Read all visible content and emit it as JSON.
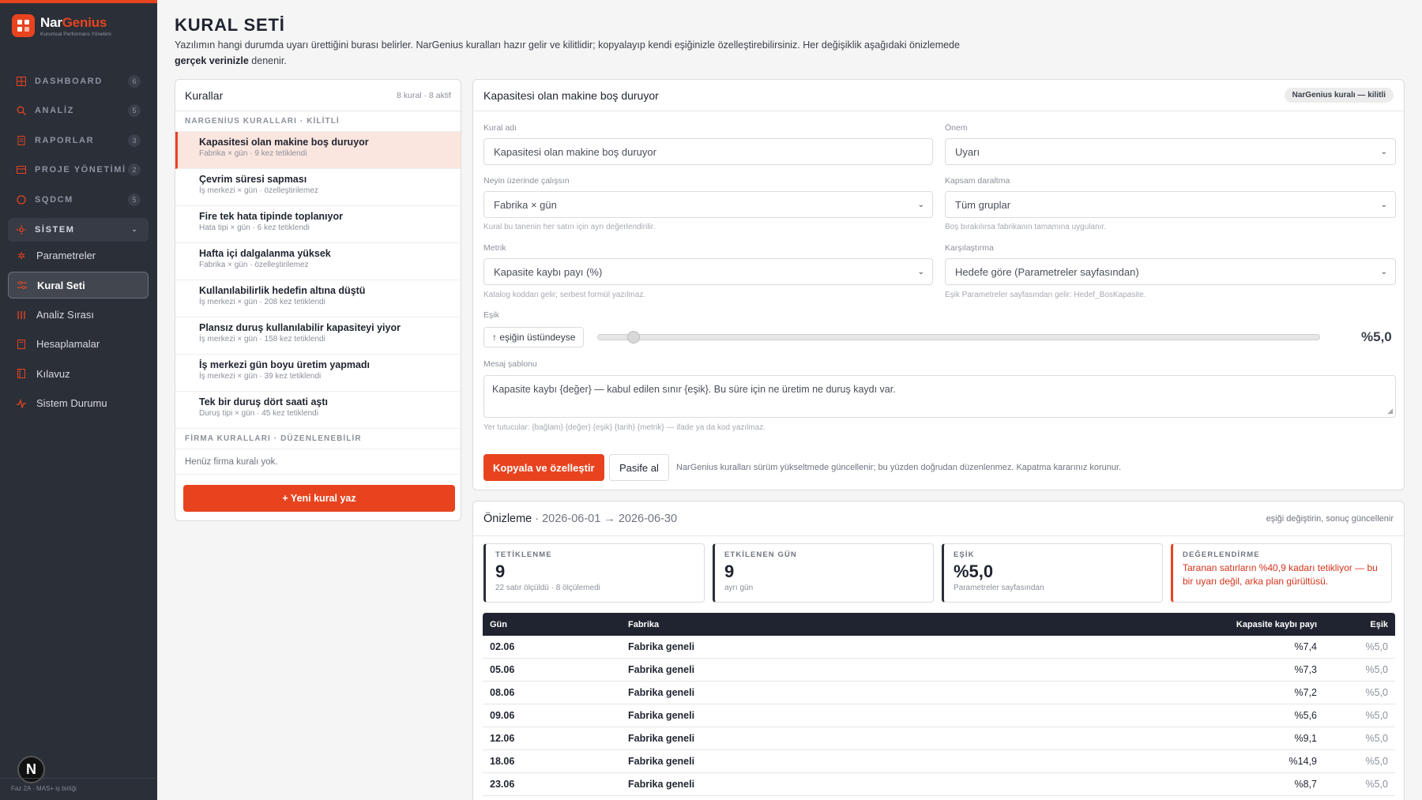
{
  "brand": {
    "name_a": "Nar",
    "name_b": "Genius",
    "subtitle": "Kurumsal Performans Yönetimi"
  },
  "nav": [
    {
      "label": "DASHBOARD",
      "count": "6",
      "icon": "dashboard-icon"
    },
    {
      "label": "ANALİZ",
      "count": "5",
      "icon": "search-icon"
    },
    {
      "label": "RAPORLAR",
      "count": "3",
      "icon": "report-icon"
    },
    {
      "label": "PROJE YÖNETİMİ",
      "count": "2",
      "icon": "project-icon"
    },
    {
      "label": "SQDCM",
      "count": "5",
      "icon": "shield-icon"
    },
    {
      "label": "SİSTEM",
      "count": "⌄",
      "icon": "gear-icon"
    }
  ],
  "subnav": [
    {
      "label": "Parametreler",
      "icon": "gear-icon"
    },
    {
      "label": "Kural Seti",
      "icon": "sliders-icon"
    },
    {
      "label": "Analiz Sırası",
      "icon": "bars-icon"
    },
    {
      "label": "Hesaplamalar",
      "icon": "calculator-icon"
    },
    {
      "label": "Kılavuz",
      "icon": "book-icon"
    },
    {
      "label": "Sistem Durumu",
      "icon": "pulse-icon"
    }
  ],
  "avatar": "N",
  "footer": "Faz 2A · MAS+ iş birliği",
  "page": {
    "title": "KURAL SETİ",
    "desc_a": "Yazılımın hangi durumda uyarı ürettiğini burası belirler. NarGenius kuralları hazır gelir ve kilitlidir; kopyalayıp kendi eşiğinizle özelleştirebilirsiniz. Her değişiklik aşağıdaki önizlemede ",
    "desc_b": "gerçek verinizle",
    "desc_c": " denenir."
  },
  "rules": {
    "title": "Kurallar",
    "meta": "8 kural · 8 aktif",
    "group_locked": "NARGENİUS KURALLARI · KİLİTLİ",
    "items": [
      {
        "title": "Kapasitesi olan makine boş duruyor",
        "sub": "Fabrika × gün · 9 kez tetiklendi"
      },
      {
        "title": "Çevrim süresi sapması",
        "sub": "İş merkezi × gün · özelleştirilemez"
      },
      {
        "title": "Fire tek hata tipinde toplanıyor",
        "sub": "Hata tipi × gün · 6 kez tetiklendi"
      },
      {
        "title": "Hafta içi dalgalanma yüksek",
        "sub": "Fabrika × gün · özelleştirilemez"
      },
      {
        "title": "Kullanılabilirlik hedefin altına düştü",
        "sub": "İş merkezi × gün · 208 kez tetiklendi"
      },
      {
        "title": "Plansız duruş kullanılabilir kapasiteyi yiyor",
        "sub": "İş merkezi × gün · 158 kez tetiklendi"
      },
      {
        "title": "İş merkezi gün boyu üretim yapmadı",
        "sub": "İş merkezi × gün · 39 kez tetiklendi"
      },
      {
        "title": "Tek bir duruş dört saati aştı",
        "sub": "Duruş tipi × gün · 45 kez tetiklendi"
      }
    ],
    "group_editable": "FİRMA KURALLARI · DÜZENLENEBİLİR",
    "empty": "Henüz firma kuralı yok.",
    "new_button": "+ Yeni kural yaz"
  },
  "editor": {
    "title": "Kapasitesi olan makine boş duruyor",
    "badge": "NarGenius kuralı — kilitli",
    "name_label": "Kural adı",
    "name_value": "Kapasitesi olan makine boş duruyor",
    "severity_label": "Önem",
    "severity_value": "Uyarı",
    "target_label": "Neyin üzerinde çalışsın",
    "target_value": "Fabrika × gün",
    "target_hint": "Kural bu tanenin her satırı için ayrı değerlendirilir.",
    "scope_label": "Kapsam daraltma",
    "scope_value": "Tüm gruplar",
    "scope_hint": "Boş bırakılırsa fabrikanın tamamına uygulanır.",
    "metric_label": "Metrik",
    "metric_value": "Kapasite kaybı payı (%)",
    "metric_hint": "Katalog koddan gelir; serbest formül yazılmaz.",
    "compare_label": "Karşılaştırma",
    "compare_value": "Hedefe göre (Parametreler sayfasından)",
    "compare_hint": "Eşik Parametreler sayfasından gelir: Hedef_BosKapasite.",
    "threshold_label": "Eşik",
    "direction": "↑ eşiğin üstündeyse",
    "threshold_value": "%5,0",
    "threshold_fraction": 0.05,
    "message_label": "Mesaj şablonu",
    "message_value": "Kapasite kaybı {değer} — kabul edilen sınır {eşik}. Bu süre için ne üretim ne duruş kaydı var.",
    "message_hint": "Yer tutucular: {bağlam} {değer} {eşik} {tarih} {metrik} — ifade ya da kod yazılmaz.",
    "copy_button": "Kopyala ve özelleştir",
    "deactivate_button": "Pasife al",
    "note": "NarGenius kuralları sürüm yükseltmede güncellenir; bu yüzden doğrudan düzenlenmez. Kapatma kararınız korunur."
  },
  "preview": {
    "title": "Önizleme",
    "range": "· 2026-06-01 → 2026-06-30",
    "right": "eşiği değiştirin, sonuç güncellenir",
    "stats": {
      "trig_k": "TETİKLENME",
      "trig_v": "9",
      "trig_s": "22 satır ölçüldü · 8 ölçülemedi",
      "days_k": "ETKİLENEN GÜN",
      "days_v": "9",
      "days_s": "ayrı gün",
      "thr_k": "EŞİK",
      "thr_v": "%5,0",
      "thr_s": "Parametreler sayfasından",
      "eval_k": "DEĞERLENDİRME",
      "eval_w": "Taranan satırların %40,9 kadarı tetikliyor — bu bir uyarı değil, arka plan gürültüsü."
    },
    "table": {
      "headers": [
        "Gün",
        "Fabrika",
        "Kapasite kaybı payı",
        "Eşik"
      ],
      "rows": [
        [
          "02.06",
          "Fabrika geneli",
          "%7,4",
          "%5,0"
        ],
        [
          "05.06",
          "Fabrika geneli",
          "%7,3",
          "%5,0"
        ],
        [
          "08.06",
          "Fabrika geneli",
          "%7,2",
          "%5,0"
        ],
        [
          "09.06",
          "Fabrika geneli",
          "%5,6",
          "%5,0"
        ],
        [
          "12.06",
          "Fabrika geneli",
          "%9,1",
          "%5,0"
        ],
        [
          "18.06",
          "Fabrika geneli",
          "%14,9",
          "%5,0"
        ],
        [
          "23.06",
          "Fabrika geneli",
          "%8,7",
          "%5,0"
        ]
      ]
    }
  },
  "colors": {
    "accent": "#e8431f",
    "sidebar": "#2b2f38",
    "table_head": "#1f2430"
  }
}
